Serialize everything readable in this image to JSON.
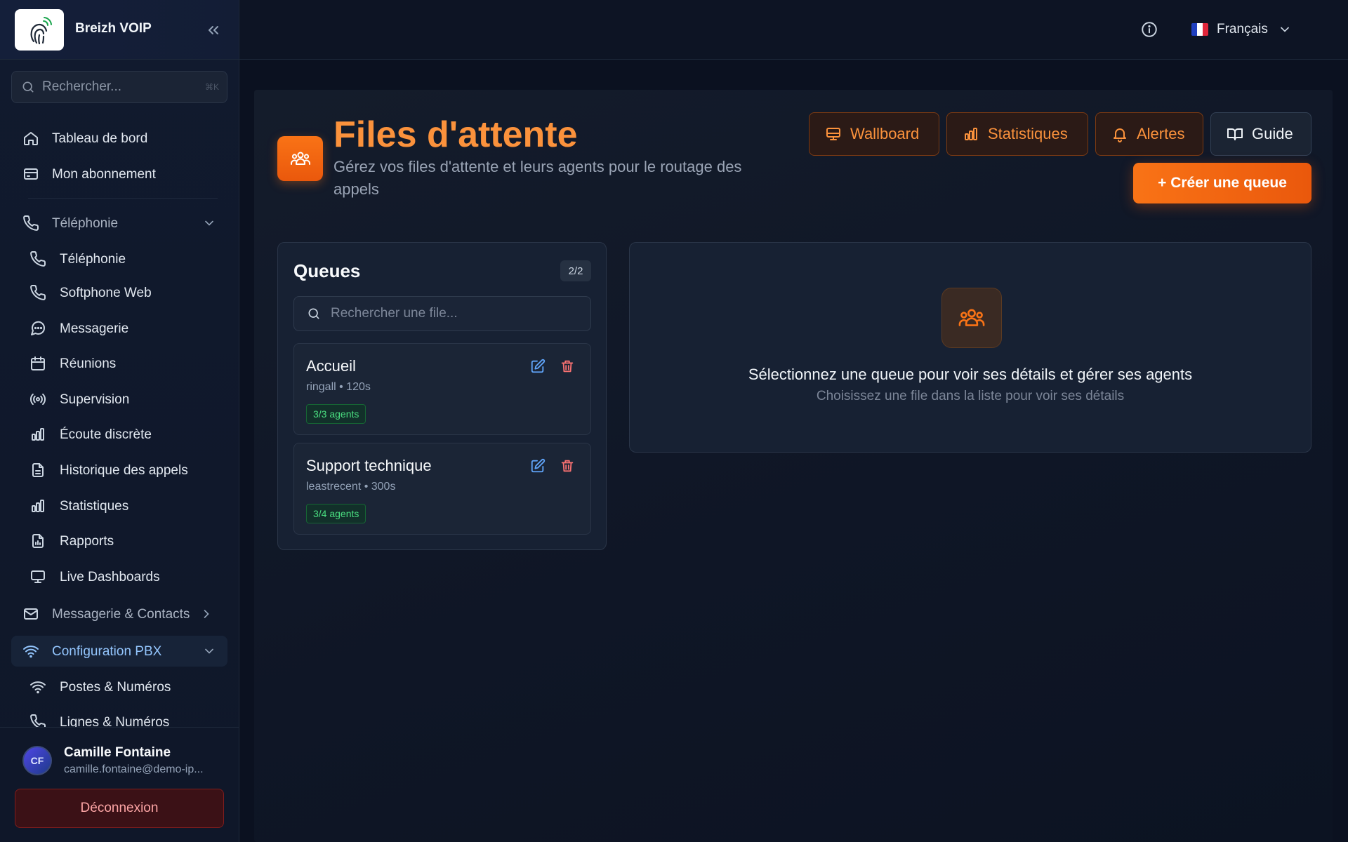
{
  "app": {
    "name": "Breizh VOIP"
  },
  "sidebar": {
    "search_placeholder": "Rechercher...",
    "search_shortcut": "⌘K",
    "items": [
      {
        "label": "Tableau de bord",
        "icon": "home-icon"
      },
      {
        "label": "Mon abonnement",
        "icon": "credit-card-icon"
      },
      {
        "label": "Téléphonie",
        "icon": "phone-icon",
        "group": true,
        "expanded": true
      },
      {
        "label": "Téléphonie",
        "icon": "phone-icon"
      },
      {
        "label": "Softphone Web",
        "icon": "phone-icon"
      },
      {
        "label": "Messagerie",
        "icon": "message-icon"
      },
      {
        "label": "Réunions",
        "icon": "calendar-icon"
      },
      {
        "label": "Supervision",
        "icon": "broadcast-icon"
      },
      {
        "label": "Écoute discrète",
        "icon": "bar-chart-icon"
      },
      {
        "label": "Historique des appels",
        "icon": "file-text-icon"
      },
      {
        "label": "Statistiques",
        "icon": "bar-chart-icon"
      },
      {
        "label": "Rapports",
        "icon": "file-chart-icon"
      },
      {
        "label": "Live Dashboards",
        "icon": "monitor-icon"
      },
      {
        "label": "Messagerie & Contacts",
        "icon": "mail-icon",
        "group": true,
        "expanded": false
      },
      {
        "label": "Configuration PBX",
        "icon": "wifi-icon",
        "group": true,
        "expanded": true,
        "active": true
      },
      {
        "label": "Postes & Numéros",
        "icon": "wifi-icon"
      },
      {
        "label": "Lignes & Numéros",
        "icon": "phone-icon"
      }
    ],
    "user": {
      "initials": "CF",
      "name": "Camille Fontaine",
      "email": "camille.fontaine@demo-ip..."
    },
    "logout_label": "Déconnexion"
  },
  "topbar": {
    "language": "Français",
    "flag_colors": [
      "#1f3fbf",
      "#ffffff",
      "#e1263b"
    ]
  },
  "page": {
    "title": "Files d'attente",
    "subtitle": "Gérez vos files d'attente et leurs agents pour le routage des appels",
    "actions": {
      "wallboard": "Wallboard",
      "statistics": "Statistiques",
      "alerts": "Alertes",
      "guide": "Guide",
      "create": "+ Créer une queue"
    }
  },
  "queues": {
    "title": "Queues",
    "count": "2/2",
    "search_placeholder": "Rechercher une file...",
    "items": [
      {
        "name": "Accueil",
        "meta": "ringall • 120s",
        "agents": "3/3 agents"
      },
      {
        "name": "Support technique",
        "meta": "leastrecent • 300s",
        "agents": "3/4 agents"
      }
    ]
  },
  "detail": {
    "empty_title": "Sélectionnez une queue pour voir ses détails et gérer ses agents",
    "empty_subtitle": "Choisissez une file dans la liste pour voir ses détails"
  },
  "colors": {
    "accent": "#f97316",
    "link": "#93c5fd",
    "success": "#4ade80",
    "danger": "#f87171"
  }
}
